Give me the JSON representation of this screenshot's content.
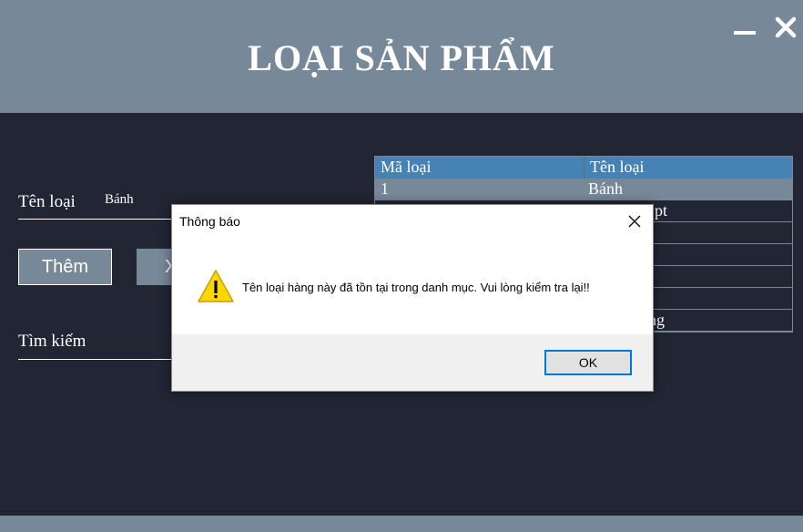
{
  "window": {
    "title": "LOẠI SẢN PHẨM",
    "minimize_icon": "minimize-icon",
    "close_icon": "close-icon"
  },
  "form": {
    "ten_loai_label": "Tên loại",
    "ten_loai_value": "Bánh",
    "them_button": "Thêm",
    "second_button_partial": "X",
    "tim_kiem_label": "Tìm kiếm"
  },
  "grid": {
    "columns": [
      "Mã loại",
      "Tên loại"
    ],
    "rows": [
      {
        "ma_loai": "1",
        "ten_loai": "Bánh",
        "selected": true
      },
      {
        "ma_loai": "",
        "ten_loai": "pt"
      },
      {
        "ma_loai": "",
        "ten_loai": ""
      },
      {
        "ma_loai": "",
        "ten_loai": ""
      },
      {
        "ma_loai": "",
        "ten_loai": ""
      },
      {
        "ma_loai": "",
        "ten_loai": ""
      },
      {
        "ma_loai": "",
        "ten_loai": "ng"
      }
    ]
  },
  "dialog": {
    "title": "Thông báo",
    "message": "Tên loại hàng này đã tồn tại trong danh mục. Vui lòng kiểm tra lại!!",
    "ok_label": "OK",
    "icon": "warning-icon",
    "close_icon": "close-icon"
  },
  "colors": {
    "background": "#222533",
    "header": "#778899",
    "grid_header": "#4682b4",
    "accent": "#0078d7"
  }
}
